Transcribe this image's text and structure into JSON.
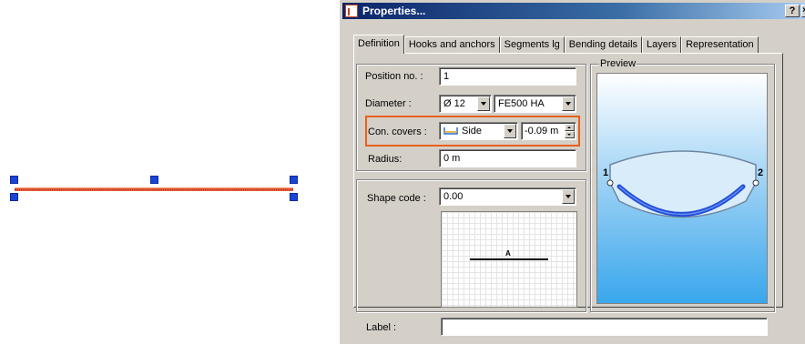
{
  "canvas": {
    "bar_color": "#e5603a",
    "grip_color": "#1a44d6"
  },
  "dialog": {
    "title": "Properties...",
    "help_label": "?",
    "close_label": "×",
    "tabs": [
      {
        "label": "Definition",
        "active": true
      },
      {
        "label": "Hooks and anchors",
        "active": false
      },
      {
        "label": "Segments lg",
        "active": false
      },
      {
        "label": "Bending details",
        "active": false
      },
      {
        "label": "Layers",
        "active": false
      },
      {
        "label": "Representation",
        "active": false
      }
    ],
    "fields": {
      "position_label": "Position no. :",
      "position_value": "1",
      "diameter_label": "Diameter :",
      "diameter_value": "Ø 12",
      "steel_grade_value": "FE500 HA",
      "covers_label": "Con. covers :",
      "covers_mode": "Side",
      "covers_value": "-0.09 m",
      "radius_label": "Radius:",
      "radius_value": "0 m"
    },
    "shape": {
      "label": "Shape code :",
      "value": "0.00",
      "segment_label": "A"
    },
    "preview": {
      "label": "Preview",
      "point_1": "1",
      "point_2": "2"
    },
    "label_field": {
      "label": "Label :",
      "value": ""
    },
    "highlight_color": "#e8601c"
  }
}
